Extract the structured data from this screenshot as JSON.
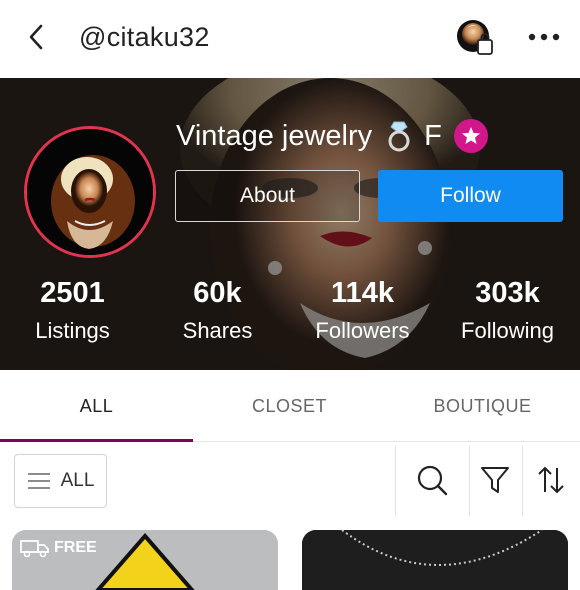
{
  "header": {
    "handle": "@citaku32"
  },
  "profile": {
    "title": "Vintage jewelry",
    "title_suffix": "F",
    "about_label": "About",
    "follow_label": "Follow"
  },
  "stats": [
    {
      "value": "2501",
      "label": "Listings"
    },
    {
      "value": "60k",
      "label": "Shares"
    },
    {
      "value": "114k",
      "label": "Followers"
    },
    {
      "value": "303k",
      "label": "Following"
    }
  ],
  "tabs": [
    {
      "label": "ALL",
      "active": true
    },
    {
      "label": "CLOSET",
      "active": false
    },
    {
      "label": "BOUTIQUE",
      "active": false
    }
  ],
  "filter": {
    "all_label": "ALL"
  },
  "cards": [
    {
      "badge": "FREE"
    }
  ],
  "colors": {
    "follow_blue": "#0f8bf2",
    "tab_underline": "#7f0353",
    "avatar_ring": "#e2334f",
    "badge_pink": "#d1178a"
  },
  "icons": [
    "back-chevron-icon",
    "shopping-bag-icon",
    "more-dots-icon",
    "diamond-ring-icon",
    "star-icon",
    "menu-lines-icon",
    "search-icon",
    "filter-funnel-icon",
    "sort-arrows-icon",
    "truck-icon"
  ]
}
